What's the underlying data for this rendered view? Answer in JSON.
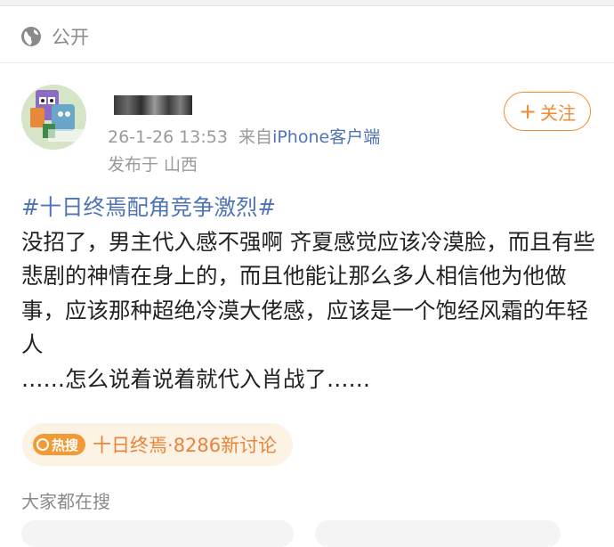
{
  "visibility": {
    "label": "公开",
    "icon": "globe-icon"
  },
  "post_header": {
    "timestamp": "26-1-26 13:53",
    "source_prefix": "来自",
    "source": "iPhone客户端",
    "location": "发布于 山西",
    "follow_label": "关注"
  },
  "post": {
    "hashtag": "#十日终焉配角竞争激烈#",
    "paragraph1": "没招了，男主代入感不强啊 齐夏感觉应该冷漠脸，而且有些悲剧的神情在身上的，而且他能让那么多人相信他为他做事，应该那种超绝冷漠大佬感，应该是一个饱经风霜的年轻人",
    "paragraph2": "……怎么说着说着就代入肖战了……"
  },
  "hot_search": {
    "badge": "热搜",
    "text": "十日终焉·8286新讨论",
    "accent": "#f29a36"
  },
  "section": {
    "title": "大家都在搜"
  },
  "colors": {
    "link": "#4e73b6",
    "follow": "#f28a2f",
    "muted": "#9a9a9a"
  }
}
